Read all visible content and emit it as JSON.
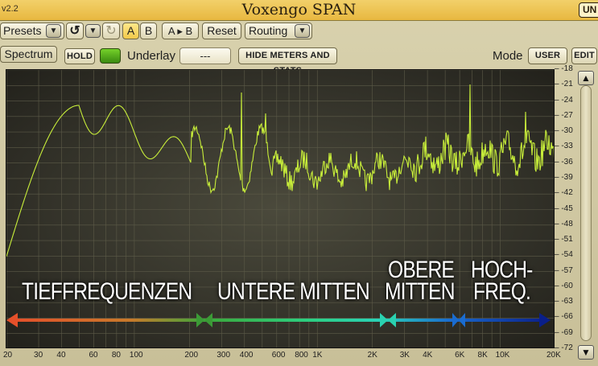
{
  "titlebar": {
    "version": "v2.2",
    "title": "Voxengo SPAN",
    "unreg": "UN"
  },
  "toolbar": {
    "presets": "Presets",
    "undo_icon": "undo-icon",
    "redo_icon": "redo-icon",
    "a": "A",
    "b": "B",
    "a_to_b": "A ▸ B",
    "reset": "Reset",
    "routing": "Routing"
  },
  "row2": {
    "spectrum": "Spectrum",
    "hold": "HOLD",
    "underlay_label": "Underlay",
    "underlay_value": "---",
    "hide_meters": "HIDE METERS AND STATS",
    "mode_label": "Mode",
    "user": "USER",
    "edit": "EDIT"
  },
  "scale": {
    "db": [
      "-18",
      "-21",
      "-24",
      "-27",
      "-30",
      "-33",
      "-36",
      "-39",
      "-42",
      "-45",
      "-48",
      "-51",
      "-54",
      "-57",
      "-60",
      "-63",
      "-66",
      "-69",
      "-72"
    ],
    "freq": [
      "20",
      "30",
      "40",
      "60",
      "80",
      "100",
      "200",
      "300",
      "400",
      "600",
      "800",
      "1K",
      "2K",
      "3K",
      "4K",
      "6K",
      "8K",
      "10K",
      "20K"
    ]
  },
  "annotations": {
    "low": "TIEFFREQUENZEN",
    "low_mid": "UNTERE MITTEN",
    "high_mid_1": "OBERE",
    "high_mid_2": "MITTEN",
    "high_1": "HOCH-",
    "high_2": "FREQ."
  },
  "colors": {
    "spectrum": "#c8ee3a",
    "title": "#f0c450"
  }
}
